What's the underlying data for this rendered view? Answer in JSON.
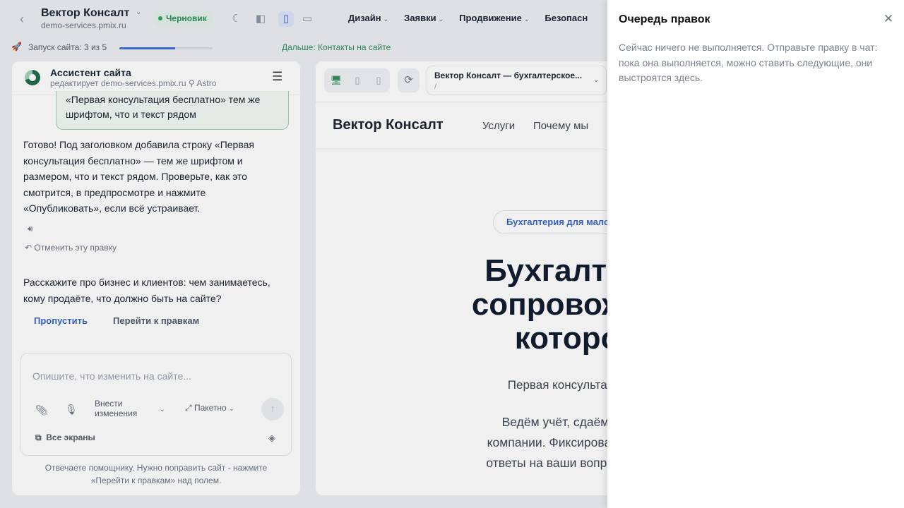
{
  "header": {
    "site_title": "Вектор Консалт",
    "site_domain": "demo-services.pmix.ru",
    "status": "Черновик",
    "nav": [
      "Дизайн",
      "Заявки",
      "Продвижение",
      "Безопасн"
    ]
  },
  "progress": {
    "label": "Запуск сайта: 3 из 5",
    "value": 0.6,
    "next_link": "Дальше: Контакты на сайте"
  },
  "chat": {
    "title": "Ассистент сайта",
    "subtitle": "редактирует demo-services.pmix.ru",
    "model": "Astro",
    "user_bubble": "«Первая консультация бесплатно» тем же шрифтом, что и текст рядом",
    "assistant_message": "Готово! Под заголовком добавила строку «Первая консультация бесплатно» — тем же шрифтом и размером, что и текст рядом. Проверьте, как это смотрится, в предпросмотре и нажмите «Опубликовать», если всё устраивает.",
    "undo_label": "Отменить эту правку",
    "question": "Расскажите про бизнес и клиентов: чем занимаетесь, кому продаёте, что должно быть на сайте?",
    "skip_label": "Пропустить",
    "goto_label": "Перейти к правкам",
    "composer": {
      "placeholder": "Опишите, что изменить на сайте...",
      "apply_label": "Внести изменения",
      "batch_label": "Пакетно",
      "screens_label": "Все экраны"
    },
    "hint": "Отвечаете помощнику. Нужно поправить сайт - нажмите «Перейти к правкам» над полем."
  },
  "preview": {
    "page_title": "Вектор Консалт — бухгалтерское...",
    "page_path": "/",
    "site": {
      "logo": "Вектор Консалт",
      "links": [
        "Услуги",
        "Почему мы"
      ],
      "tag": "Бухгалтерия для малого",
      "hero_title": "Бухгалтерское\nсопровождение,\nкоторое не",
      "hero_sub": "Первая консультация бесплатно",
      "hero_desc": "Ведём учёт, сдаём отчётность и\nкомпании. Фиксированная стоимость\nответы на ваши вопросы — вы заним"
    }
  },
  "queue": {
    "title": "Очередь правок",
    "empty_text": "Сейчас ничего не выполняется. Отправьте правку в чат: пока она выполняется, можно ставить следующие, они выстроятся здесь."
  }
}
